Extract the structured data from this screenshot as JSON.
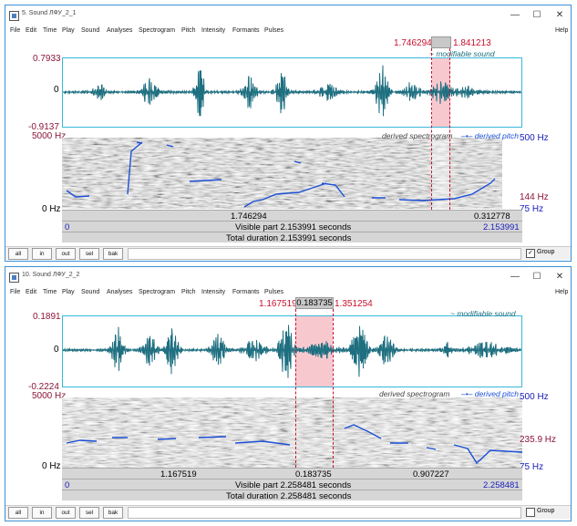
{
  "menu": [
    "File",
    "Edit",
    "Time",
    "Play",
    "Sound",
    "Analyses",
    "Spectrogram",
    "Pitch",
    "Intensity",
    "Formants",
    "Pulses"
  ],
  "help": "Help",
  "buttons": {
    "all": "all",
    "in": "in",
    "out": "out",
    "sel": "sel",
    "bak": "bak"
  },
  "group_label": "Group",
  "win_controls": {
    "min": "—",
    "max": "☐",
    "close": "✕"
  },
  "windows": [
    {
      "title": "5. Sound ЛФУ_2_1",
      "sel_start": "1.746294",
      "sel_len": "",
      "sel_end": "1.841213",
      "amp_max": "0.7933",
      "amp_zero": "0",
      "amp_min": "-0.9137",
      "modifiable": "~ modifiable sound",
      "freq_top": "5000 Hz",
      "freq_bottom": "0 Hz",
      "derived_spec": "derived spectrogram",
      "derived_pitch": "derived pitch",
      "pitch_top": "500 Hz",
      "pitch_mid": "144 Hz",
      "pitch_bottom": "75 Hz",
      "seg_left": "1.746294",
      "seg_mid": "",
      "seg_right": "0.312778",
      "vis_start": "0",
      "visible_part": "Visible part 2.153991 seconds",
      "vis_end": "2.153991",
      "total": "Total duration 2.153991 seconds",
      "group_checked": "✓"
    },
    {
      "title": "10. Sound ЛФУ_2_2",
      "sel_start": "1.167519",
      "sel_len": "0.183735",
      "sel_end": "1.351254",
      "amp_max": "0.1891",
      "amp_zero": "0",
      "amp_min": "-0.2224",
      "modifiable": "~ modifiable sound",
      "freq_top": "5000 Hz",
      "freq_bottom": "0 Hz",
      "derived_spec": "derived spectrogram",
      "derived_pitch": "derived pitch",
      "pitch_top": "500 Hz",
      "pitch_mid": "235.9 Hz",
      "pitch_bottom": "75 Hz",
      "seg_left": "1.167519",
      "seg_mid": "0.183735",
      "seg_right": "0.907227",
      "vis_start": "0",
      "visible_part": "Visible part 2.258481 seconds",
      "vis_end": "2.258481",
      "total": "Total duration 2.258481 seconds",
      "group_checked": ""
    }
  ],
  "colors": {
    "wave": "#1e6f80",
    "pitch": "#1a4fd6",
    "selection": "#f7c9cf",
    "frame": "#37b8d9"
  }
}
